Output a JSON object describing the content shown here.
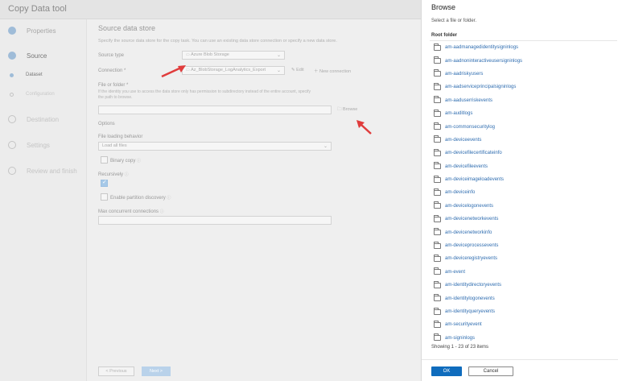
{
  "tool": {
    "title": "Copy Data tool",
    "steps": [
      {
        "label": "Properties"
      },
      {
        "label": "Source"
      },
      {
        "label": "Dataset"
      },
      {
        "label": "Configuration"
      },
      {
        "label": "Destination"
      },
      {
        "label": "Settings"
      },
      {
        "label": "Review and finish"
      }
    ],
    "form": {
      "title": "Source data store",
      "description": "Specify the source data store for the copy task. You can use an existing data store connection or specify a new data store.",
      "source_type_label": "Source type",
      "source_type_value": "Azure Blob Storage",
      "connection_label": "Connection *",
      "connection_value": "Az_BlobStorage_LogAnalytics_Export",
      "edit_label": "Edit",
      "new_connection_label": "New connection",
      "file_folder_label": "File or folder *",
      "file_folder_note": "If the identity you use to access the data store only has permission to subdirectory instead of the entire account, specify the path to browse.",
      "browse_label": "Browse",
      "options_label": "Options",
      "file_loading_label": "File loading behavior",
      "file_loading_value": "Load all files",
      "binary_copy_label": "Binary copy",
      "recursively_label": "Recursively",
      "partition_label": "Enable partition discovery",
      "max_conn_label": "Max concurrent connections"
    },
    "footer": {
      "previous_label": "< Previous",
      "next_label": "Next >"
    }
  },
  "browse": {
    "title": "Browse",
    "subtitle": "Select a file or folder.",
    "root_label": "Root folder",
    "items": [
      "am-aadmanagedidentitysigninlogs",
      "am-aadnoninteractiveusersigninlogs",
      "am-aadriskyusers",
      "am-aadserviceprincipalsigninlogs",
      "am-aaduserriskevents",
      "am-auditlogs",
      "am-commonsecuritylog",
      "am-deviceevents",
      "am-devicefilecertificateinfo",
      "am-devicefileevents",
      "am-deviceimageloadevents",
      "am-deviceinfo",
      "am-devicelogonevents",
      "am-devicenetworkevents",
      "am-devicenetworkinfo",
      "am-deviceprocessevents",
      "am-deviceregistryevents",
      "am-event",
      "am-identitydirectoryevents",
      "am-identitylogonevents",
      "am-identityqueryevents",
      "am-securityevent",
      "am-signinlogs"
    ],
    "status": "Showing 1 - 23 of 23 items",
    "ok_label": "OK",
    "cancel_label": "Cancel"
  },
  "colors": {
    "accent": "#0f6cbd",
    "link": "#2f6db0",
    "annotation_arrow": "#e03c3c"
  }
}
